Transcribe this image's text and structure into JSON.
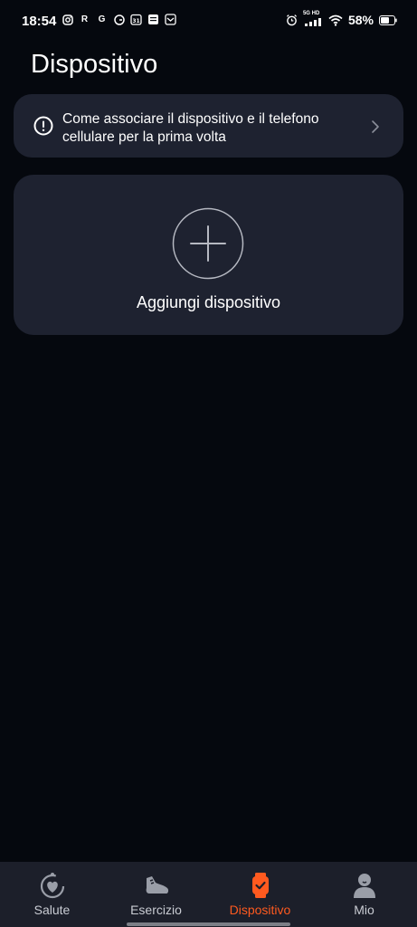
{
  "status_bar": {
    "time": "18:54",
    "notification_icons": [
      "instagram-icon",
      "r-app-icon",
      "google-icon",
      "g-circle-icon",
      "calendar-icon",
      "app-grid-icon",
      "inbox-icon"
    ],
    "r_letter": "R",
    "g_letter": "G",
    "calendar_day": "31",
    "network_label": "5G HD",
    "battery": "58%"
  },
  "page": {
    "title": "Dispositivo"
  },
  "info_banner": {
    "text": "Come associare il dispositivo e il telefono cellulare per la prima volta",
    "icon": "info-circle-icon"
  },
  "add_card": {
    "label": "Aggiungi dispositivo",
    "icon": "plus-circle-icon"
  },
  "bottom_nav": {
    "items": [
      {
        "label": "Salute",
        "icon": "health-icon",
        "active": false
      },
      {
        "label": "Esercizio",
        "icon": "shoe-icon",
        "active": false
      },
      {
        "label": "Dispositivo",
        "icon": "watch-icon",
        "active": true
      },
      {
        "label": "Mio",
        "icon": "profile-icon",
        "active": false
      }
    ]
  },
  "colors": {
    "background": "#05080e",
    "card": "#1e2230",
    "accent": "#ff5a1f",
    "nav_bg": "#1c1f2a"
  }
}
